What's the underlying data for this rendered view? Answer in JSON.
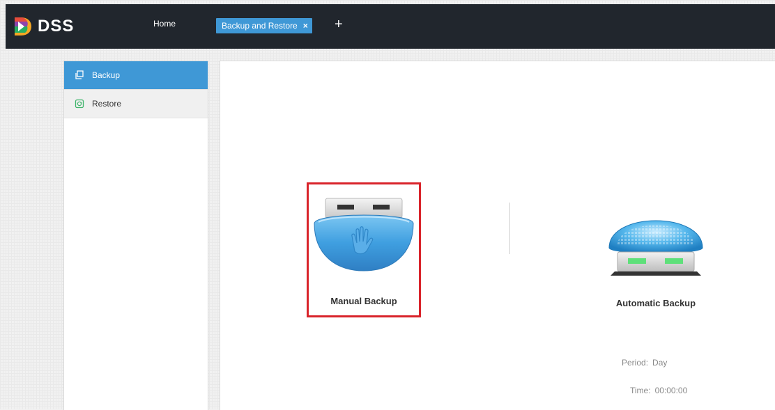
{
  "app": {
    "logo_text": "DSS"
  },
  "nav": {
    "home_label": "Home",
    "active_tab_label": "Backup and Restore",
    "close_glyph": "×",
    "add_glyph": "+"
  },
  "sidebar": {
    "items": [
      {
        "label": "Backup",
        "icon": "copy-icon",
        "active": true
      },
      {
        "label": "Restore",
        "icon": "restore-icon",
        "active": false
      }
    ]
  },
  "main": {
    "manual_backup_label": "Manual Backup",
    "automatic_backup_label": "Automatic Backup",
    "period_label": "Period:",
    "period_value": "Day",
    "time_label": "Time:",
    "time_value": "00:00:00"
  },
  "colors": {
    "topbar": "#21262d",
    "accent": "#3f98d6",
    "highlight_border": "#d9232a"
  }
}
